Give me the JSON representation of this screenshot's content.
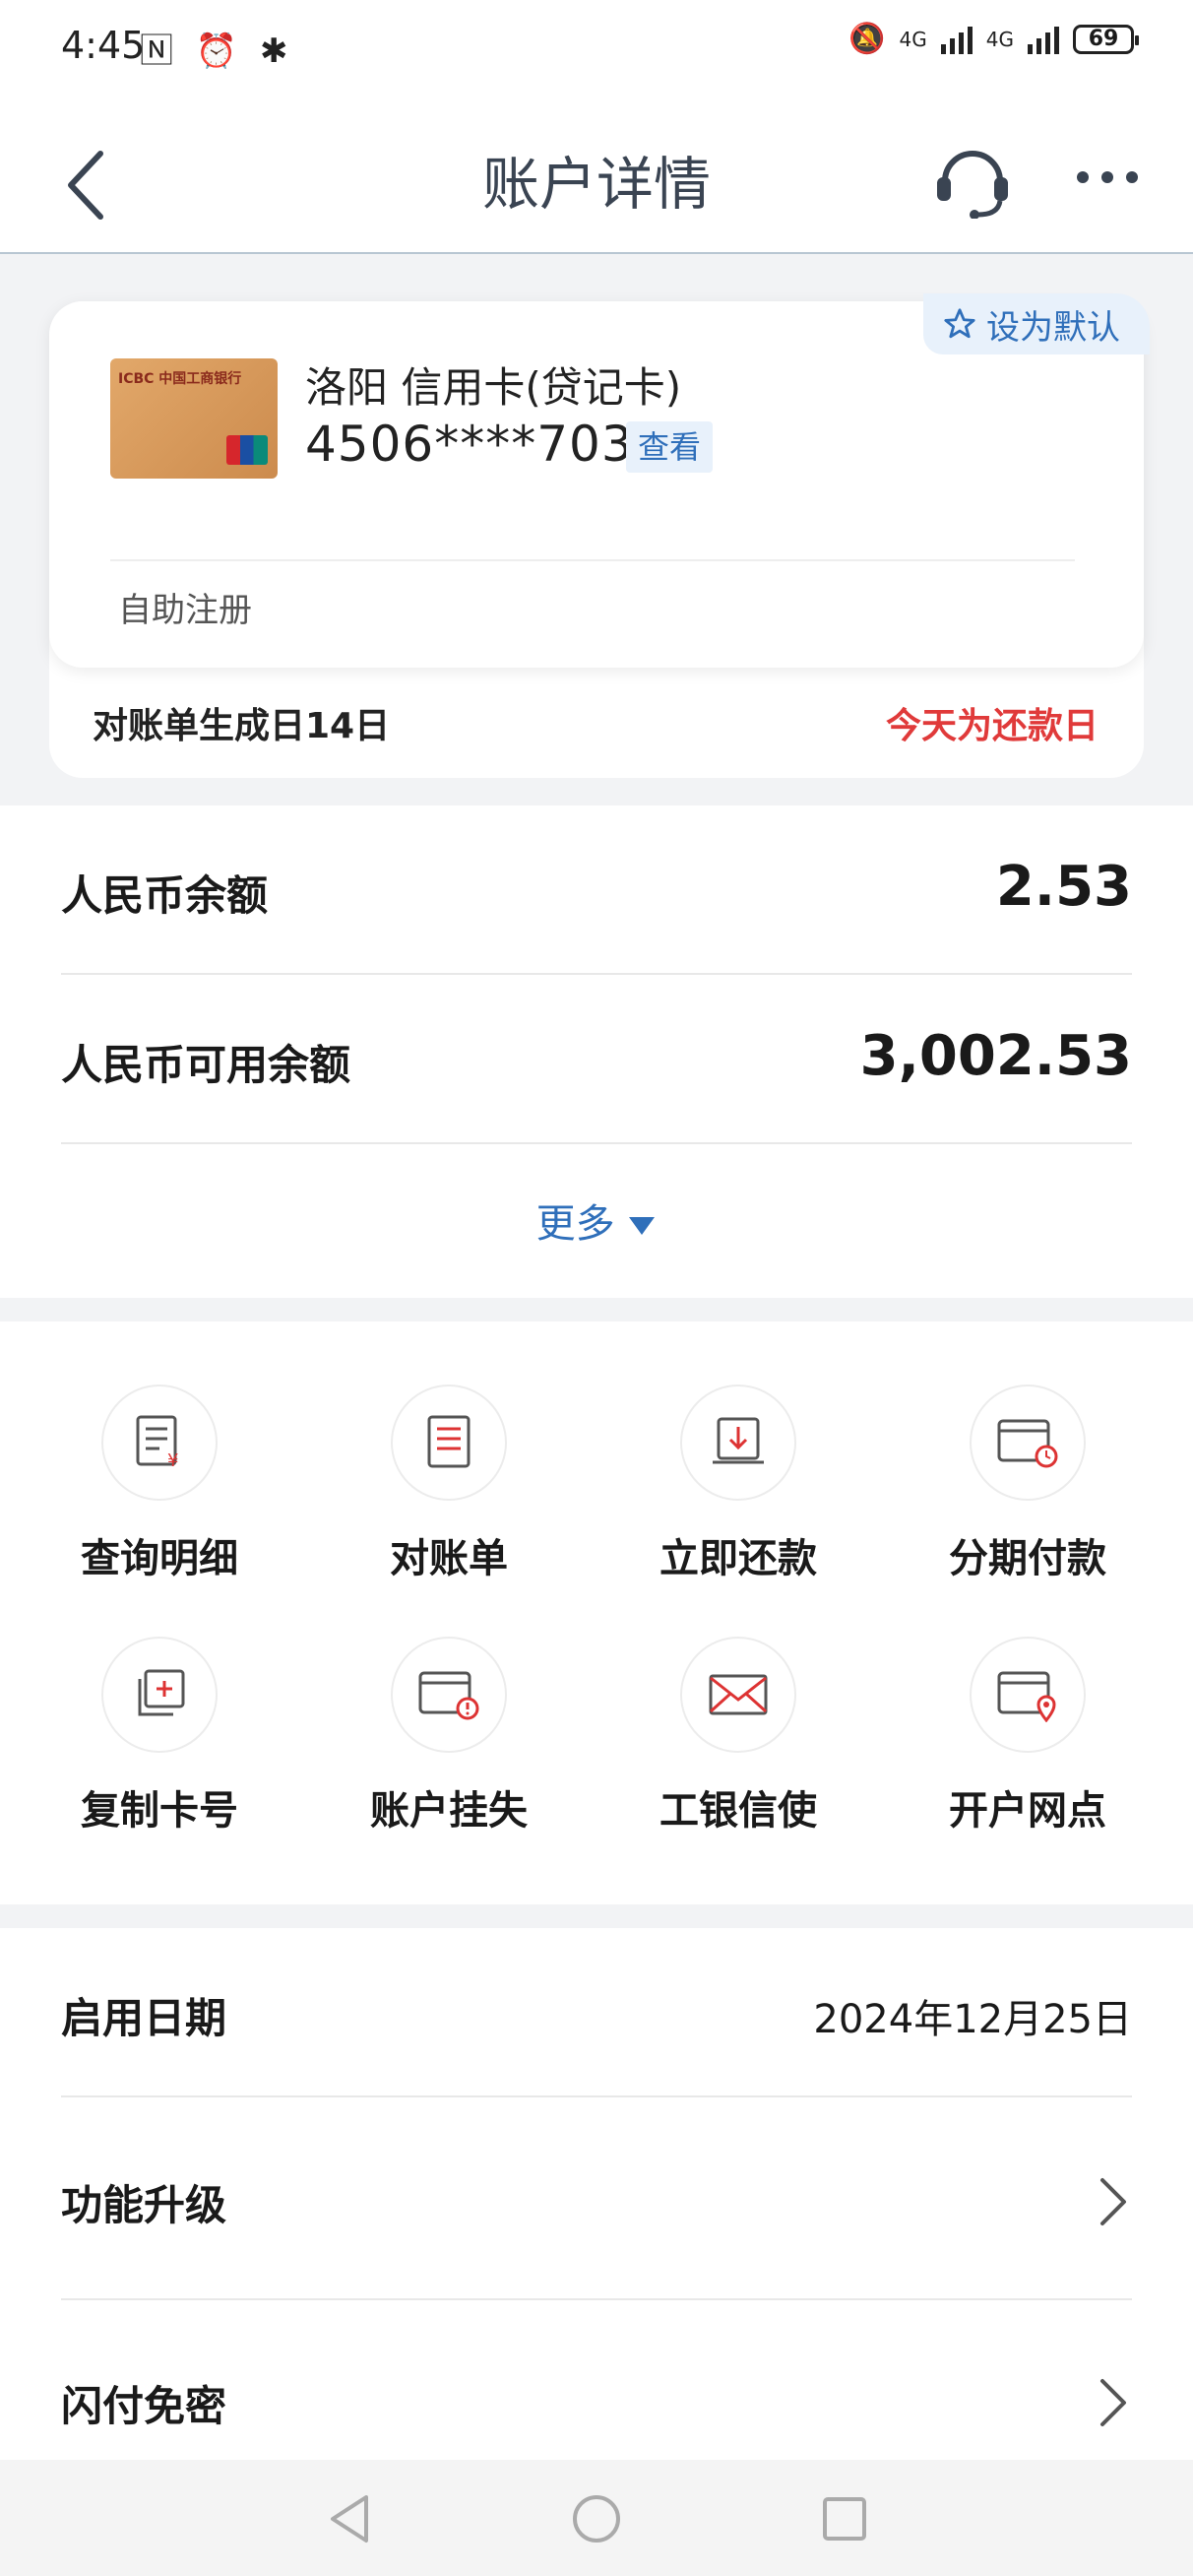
{
  "status_bar": {
    "time": "4:45",
    "left_icons": "🄽 ⏰ ✱",
    "signal_1": "4G",
    "signal_2": "4G",
    "battery": "69"
  },
  "header": {
    "title": "账户详情",
    "back_icon": "chevron-left-icon",
    "support_icon": "headset-icon",
    "more_icon": "more-dots-icon"
  },
  "card": {
    "default_label": "设为默认",
    "name": "洛阳 信用卡(贷记卡)",
    "number": "4506****7037",
    "view_label": "查看",
    "self_register": "自助注册",
    "bill_day": "对账单生成日14日",
    "due_day": "今天为还款日",
    "logo_text": "ICBC 中国工商银行",
    "colors": {
      "accent": "#2f6fba",
      "due": "#e03a3a"
    }
  },
  "balances": [
    {
      "label": "人民币余额",
      "value": "2.53"
    },
    {
      "label": "人民币可用余额",
      "value": "3,002.53"
    }
  ],
  "more_label": "更多",
  "functions": [
    {
      "label": "查询明细",
      "icon": "detail-query-icon"
    },
    {
      "label": "对账单",
      "icon": "statement-icon"
    },
    {
      "label": "立即还款",
      "icon": "repay-icon"
    },
    {
      "label": "分期付款",
      "icon": "installment-icon"
    },
    {
      "label": "复制卡号",
      "icon": "copy-card-icon"
    },
    {
      "label": "账户挂失",
      "icon": "report-loss-icon"
    },
    {
      "label": "工银信使",
      "icon": "mail-icon"
    },
    {
      "label": "开户网点",
      "icon": "branch-location-icon"
    }
  ],
  "info": {
    "activation_label": "启用日期",
    "activation_value": "2024年12月25日",
    "upgrade_label": "功能升级",
    "flashpay_label": "闪付免密"
  }
}
